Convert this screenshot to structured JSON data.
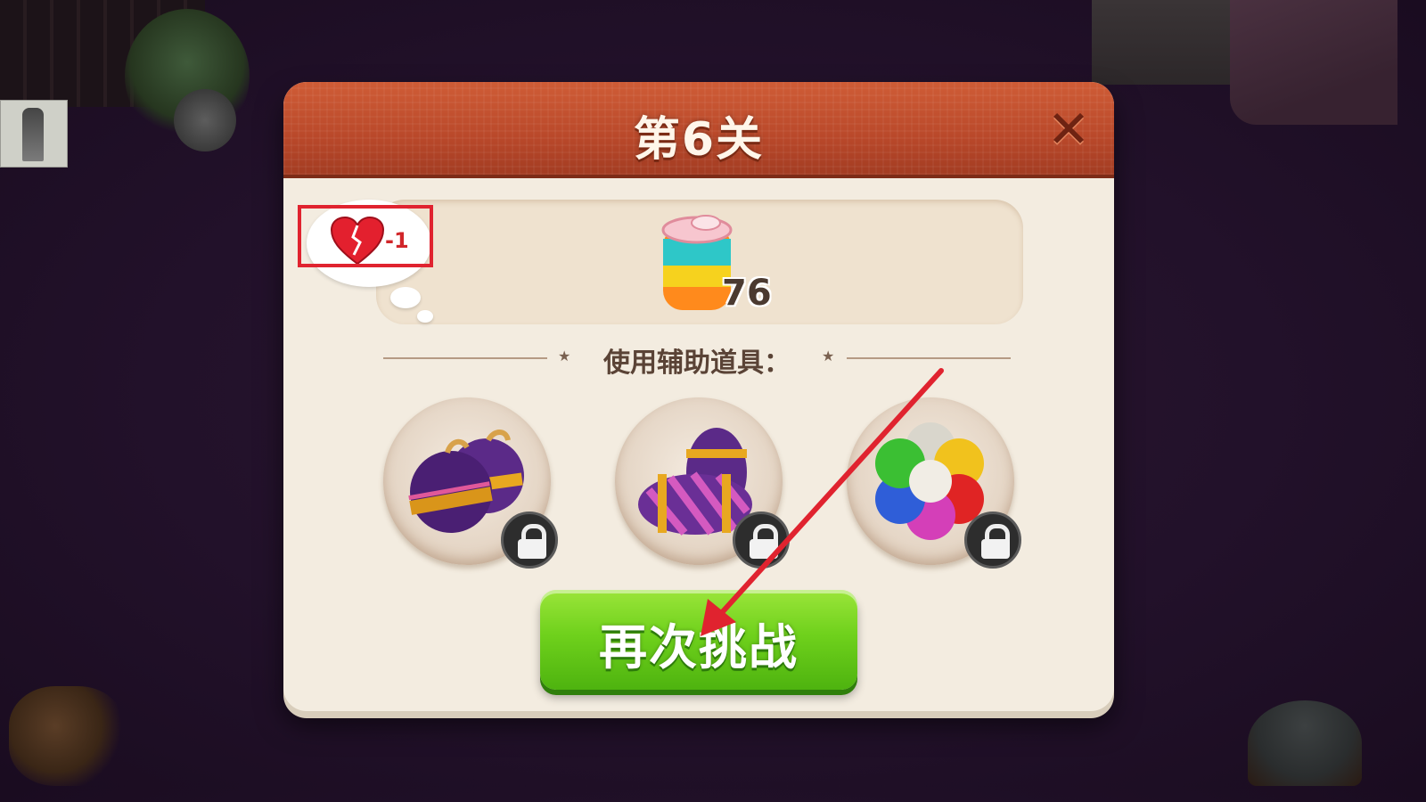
{
  "level_dialog": {
    "title": "第6关",
    "close_icon": "close-icon",
    "goal": {
      "icon": "juice-can-icon",
      "count": "76"
    },
    "life_penalty": {
      "icon": "broken-heart-icon",
      "text": "-1"
    },
    "boosters_label": "使用辅助道具：",
    "boosters": [
      {
        "icon": "bomb-pair-icon",
        "locked": true
      },
      {
        "icon": "striped-firecracker-icon",
        "locked": true
      },
      {
        "icon": "rainbow-ball-icon",
        "locked": true
      }
    ],
    "retry_label": "再次挑战"
  },
  "colors": {
    "header": "#c0502d",
    "panel": "#f3ece0",
    "button": "#6fd11c",
    "highlight": "#e0232f",
    "arrow": "#e0232f"
  }
}
